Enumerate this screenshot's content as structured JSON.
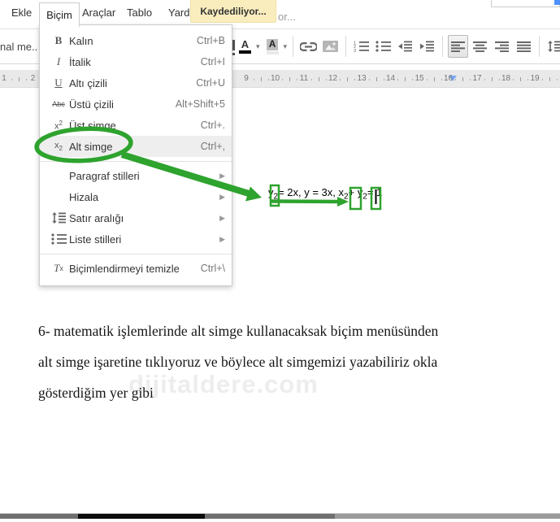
{
  "menubar": {
    "items": [
      {
        "name": "ekle",
        "label": "Ekle"
      },
      {
        "name": "bicim",
        "label": "Biçim"
      },
      {
        "name": "araclar",
        "label": "Araçlar"
      },
      {
        "name": "tablo",
        "label": "Tablo"
      },
      {
        "name": "yardim",
        "label": "Yard"
      }
    ]
  },
  "save_badge": {
    "label": "Kaydediliyor...",
    "overflow_text": "or..."
  },
  "toolbar": {
    "styles_label": "nal me...",
    "icons": [
      {
        "name": "text-color-icon",
        "dropdown": true
      },
      {
        "name": "highlight-color-icon",
        "dropdown": true
      },
      {
        "separator": true
      },
      {
        "name": "insert-link-icon"
      },
      {
        "name": "insert-image-icon"
      },
      {
        "separator": true
      },
      {
        "name": "numbered-list-icon"
      },
      {
        "name": "bulleted-list-icon"
      },
      {
        "name": "decrease-indent-icon"
      },
      {
        "name": "increase-indent-icon"
      },
      {
        "separator": true
      },
      {
        "name": "align-left-icon",
        "active": true
      },
      {
        "name": "align-center-icon"
      },
      {
        "name": "align-right-icon"
      },
      {
        "name": "justify-icon"
      },
      {
        "separator": true
      },
      {
        "name": "line-spacing-icon"
      }
    ]
  },
  "ruler": {
    "left_numbers": [
      "1",
      "2"
    ],
    "numbers": [
      "9",
      "10",
      "11",
      "12",
      "13",
      "14",
      "15",
      "16",
      "17",
      "18",
      "19"
    ]
  },
  "format_menu": {
    "items": [
      {
        "name": "bold",
        "icon": "bold-icon",
        "label": "Kalın",
        "shortcut": "Ctrl+B"
      },
      {
        "name": "italic",
        "icon": "italic-icon",
        "label": "İtalik",
        "shortcut": "Ctrl+I"
      },
      {
        "name": "underline",
        "icon": "underline-icon",
        "label": "Altı çizili",
        "shortcut": "Ctrl+U"
      },
      {
        "name": "strikethrough",
        "icon": "strikethrough-icon",
        "label": "Üstü çizili",
        "shortcut": "Alt+Shift+5"
      },
      {
        "name": "superscript",
        "icon": "superscript-icon",
        "label": "Üst simge",
        "shortcut": "Ctrl+."
      },
      {
        "name": "subscript",
        "icon": "subscript-icon",
        "label": "Alt simge",
        "shortcut": "Ctrl+,",
        "highlighted": true
      },
      {
        "separator": true
      },
      {
        "name": "paragraph-styles",
        "label": "Paragraf stilleri",
        "submenu": true
      },
      {
        "name": "align",
        "label": "Hizala",
        "submenu": true
      },
      {
        "name": "line-spacing",
        "icon": "line-spacing-icon",
        "label": "Satır aralığı",
        "submenu": true
      },
      {
        "name": "list-styles",
        "icon": "list-styles-icon",
        "label": "Liste stilleri",
        "submenu": true
      },
      {
        "separator": true
      },
      {
        "name": "clear-formatting",
        "icon": "clear-formatting-icon",
        "label": "Biçimlendirmeyi temizle",
        "shortcut": "Ctrl+\\"
      }
    ]
  },
  "document": {
    "equation_segments": [
      {
        "text": "y"
      },
      {
        "text": "2",
        "subscript": true,
        "boxed": true
      },
      {
        "text": "= 2x, y = 3x, x"
      },
      {
        "text": "2",
        "subscript": true,
        "boxed": true
      },
      {
        "text": "+ y"
      },
      {
        "text": "2",
        "subscript": true,
        "boxed": true,
        "cursor": true
      },
      {
        "text": "= 1"
      }
    ],
    "paragraph_lines": [
      "6- matematik işlemlerinde alt simge kullanacaksak biçim menüsünden",
      "alt simge işaretine tıklıyoruz ve böylece alt simgemizi yazabiliriz okla",
      "gösterdiğim yer gibi"
    ],
    "watermark": "dijitaldere.com"
  },
  "colors": {
    "annotation_green": "#2ea32e",
    "badge_background": "#f9edbe",
    "ruler_marker_blue": "#7baaf7",
    "icon_gray": "#666666",
    "corner_button_blue": "#4d90fe"
  }
}
